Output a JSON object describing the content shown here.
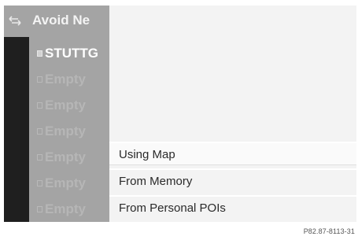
{
  "header": {
    "back_icon": "back-arrow-icon",
    "title": "Avoid Ne"
  },
  "list": {
    "items": [
      {
        "label": "STUTTG",
        "active": true
      },
      {
        "label": "Empty",
        "active": false
      },
      {
        "label": "Empty",
        "active": false
      },
      {
        "label": "Empty",
        "active": false
      },
      {
        "label": "Empty",
        "active": false
      },
      {
        "label": "Empty",
        "active": false
      },
      {
        "label": "Empty",
        "active": false
      }
    ]
  },
  "menu": {
    "items": [
      {
        "label": "Using Map",
        "selected": true
      },
      {
        "label": "From Memory",
        "selected": false
      },
      {
        "label": "From Personal POIs",
        "selected": false
      }
    ]
  },
  "footer": {
    "image_code": "P82.87-8113-31"
  },
  "colors": {
    "panel_gray": "#a4a4a4",
    "strip_dark": "#1f1f1f",
    "menu_bg": "#f3f3f3",
    "menu_text": "#2a2a2a"
  }
}
